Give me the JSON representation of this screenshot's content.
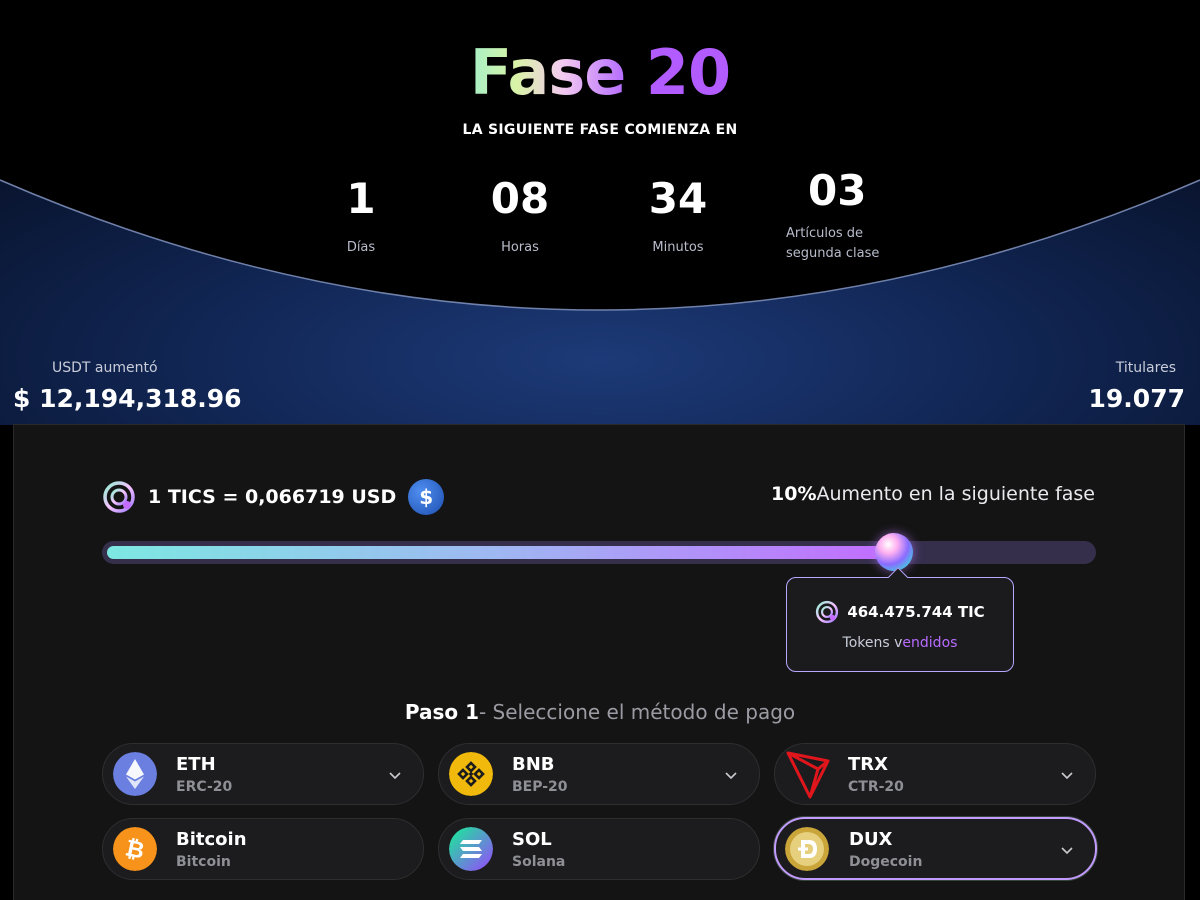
{
  "header": {
    "title_word": "Fase",
    "title_number": "20",
    "subtitle": "LA SIGUIENTE FASE COMIENZA EN"
  },
  "countdown": [
    {
      "value": "1",
      "label": "Días"
    },
    {
      "value": "08",
      "label": "Horas"
    },
    {
      "value": "34",
      "label": "Minutos"
    },
    {
      "value": "03",
      "label": "Artículos de segunda clase"
    }
  ],
  "stats": {
    "raised_label": "USDT aumentó",
    "raised_value": "$ 12,194,318.96",
    "holders_label": "Titulares",
    "holders_value": "19.077"
  },
  "price": {
    "rate_text": "1 TICS = 0,066719 USD",
    "currency_symbol": "$",
    "increase_percent": "10%",
    "increase_text": "Aumento en la siguiente fase"
  },
  "progress": {
    "fraction": 0.8,
    "sold_amount": "464.475.744 TIC",
    "sold_label_a": "Tokens v",
    "sold_label_b": "endidos"
  },
  "step": {
    "prefix": "Paso 1",
    "text": "- Seleccione el método de pago"
  },
  "payment_methods": [
    {
      "name": "ETH",
      "network": "ERC-20",
      "icon": "ethereum-icon",
      "color": "#6a7fe0",
      "dropdown": true,
      "selected": false
    },
    {
      "name": "BNB",
      "network": "BEP-20",
      "icon": "bnb-icon",
      "color": "#f0b90b",
      "dropdown": true,
      "selected": false
    },
    {
      "name": "TRX",
      "network": "CTR-20",
      "icon": "tron-icon",
      "color": "#e0161c",
      "dropdown": true,
      "selected": false
    },
    {
      "name": "Bitcoin",
      "network": "Bitcoin",
      "icon": "bitcoin-icon",
      "color": "#f7931a",
      "dropdown": false,
      "selected": false
    },
    {
      "name": "SOL",
      "network": "Solana",
      "icon": "solana-icon",
      "color": "#9945ff",
      "dropdown": false,
      "selected": false
    },
    {
      "name": "DUX",
      "network": "Dogecoin",
      "icon": "dogecoin-icon",
      "color": "#c9a53a",
      "dropdown": true,
      "selected": true
    }
  ],
  "colors": {
    "accent_purple": "#b25cff",
    "panel_bg": "#141414",
    "hero_blue": "#1d3a78"
  }
}
